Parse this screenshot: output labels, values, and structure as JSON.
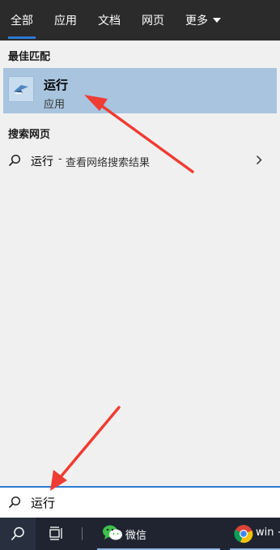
{
  "tabs": [
    {
      "label": "全部"
    },
    {
      "label": "应用"
    },
    {
      "label": "文档"
    },
    {
      "label": "网页"
    },
    {
      "label": "更多"
    }
  ],
  "best_match": {
    "section_title": "最佳匹配",
    "name": "运行",
    "type": "应用"
  },
  "web_search": {
    "section_title": "搜索网页",
    "query": "运行",
    "separator": "-",
    "description": "查看网络搜索结果"
  },
  "search_box": {
    "value": "运行"
  },
  "taskbar": {
    "wechat_label": "微信",
    "chrome_label": "win +"
  },
  "colors": {
    "accent": "#2c7bd3",
    "selected_bg": "#a8c4de",
    "annotation_arrow": "#f03c32",
    "taskbar_bg": "#1f2430"
  }
}
